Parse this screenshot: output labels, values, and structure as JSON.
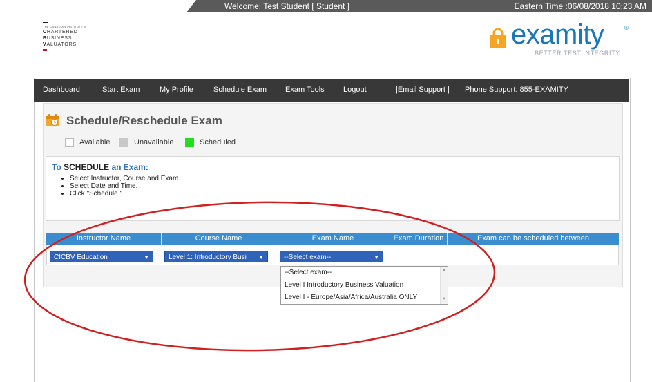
{
  "header": {
    "welcome": "Welcome: Test Student [ Student ]",
    "time": "Eastern Time :06/08/2018 10:23 AM"
  },
  "cbv_logo": {
    "small": "THE CANADIAN INSTITUTE of",
    "line1_b": "C",
    "line1": "HARTERED",
    "line2_b": "B",
    "line2": "USINESS",
    "line3_b": "V",
    "line3": "ALUATORS"
  },
  "examity_logo": {
    "word": "examity",
    "tagline": "BETTER TEST INTEGRITY.",
    "reg": "®"
  },
  "nav": {
    "items": [
      "Dashboard",
      "Start Exam",
      "My Profile",
      "Schedule Exam",
      "Exam Tools",
      "Logout",
      "|Email Support |",
      "Phone Support: 855-EXAMITY"
    ]
  },
  "page": {
    "title": "Schedule/Reschedule Exam",
    "legend": [
      "Available",
      "Unavailable",
      "Scheduled"
    ]
  },
  "instructions": {
    "head_pre": "To ",
    "head_bold": "SCHEDULE",
    "head_post": " an Exam:",
    "steps": [
      "Select Instructor, Course and Exam.",
      "Select Date and Time.",
      "Click \"Schedule.\""
    ]
  },
  "table": {
    "headers": [
      "Instructor Name",
      "Course Name",
      "Exam Name",
      "Exam Duration",
      "Exam can be scheduled between"
    ],
    "instructor_value": "CICBV Education",
    "course_value": "Level 1: Introductory Busi",
    "exam_value": "--Select exam--"
  },
  "dropdown": {
    "options": [
      "--Select exam--",
      "Level I Introductory Business Valuation",
      "Level I - Europe/Asia/Africa/Australia ONLY"
    ]
  },
  "colors": {
    "nav_bg": "#383838",
    "table_head": "#3a8ed0",
    "select_bg": "#2f63b9",
    "scheduled": "#22dd22",
    "unavailable": "#c8c8c8",
    "examity_blue": "#1978b8",
    "examity_orange": "#f5a623",
    "annotation_red": "#d02020"
  }
}
